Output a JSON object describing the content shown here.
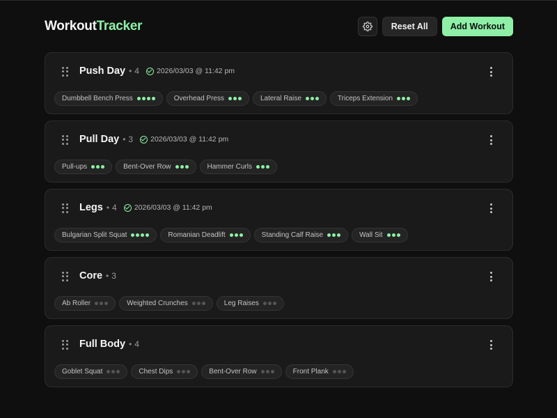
{
  "app": {
    "title_part1": "Workout",
    "title_part2": "Tracker"
  },
  "header": {
    "settings_icon": "gear-icon",
    "reset_label": "Reset All",
    "add_label": "Add Workout"
  },
  "colors": {
    "accent": "#8ef0a6",
    "background": "#0f0f0f",
    "card": "#1a1a1a",
    "dot_off": "#555555"
  },
  "workouts": [
    {
      "name": "Push Day",
      "separator": "•",
      "count": "4",
      "completed": "2026/03/03 @ 11:42 pm",
      "exercises": [
        {
          "name": "Dumbbell Bench Press",
          "sets_total": 4,
          "sets_done": 4
        },
        {
          "name": "Overhead Press",
          "sets_total": 3,
          "sets_done": 3
        },
        {
          "name": "Lateral Raise",
          "sets_total": 3,
          "sets_done": 3
        },
        {
          "name": "Triceps Extension",
          "sets_total": 3,
          "sets_done": 3
        }
      ]
    },
    {
      "name": "Pull Day",
      "separator": "•",
      "count": "3",
      "completed": "2026/03/03 @ 11:42 pm",
      "exercises": [
        {
          "name": "Pull-ups",
          "sets_total": 3,
          "sets_done": 3
        },
        {
          "name": "Bent-Over Row",
          "sets_total": 3,
          "sets_done": 3
        },
        {
          "name": "Hammer Curls",
          "sets_total": 3,
          "sets_done": 3
        }
      ]
    },
    {
      "name": "Legs",
      "separator": "•",
      "count": "4",
      "completed": "2026/03/03 @ 11:42 pm",
      "exercises": [
        {
          "name": "Bulgarian Split Squat",
          "sets_total": 4,
          "sets_done": 4
        },
        {
          "name": "Romanian Deadlift",
          "sets_total": 3,
          "sets_done": 3
        },
        {
          "name": "Standing Calf Raise",
          "sets_total": 3,
          "sets_done": 3
        },
        {
          "name": "Wall Sit",
          "sets_total": 3,
          "sets_done": 3
        }
      ]
    },
    {
      "name": "Core",
      "separator": "•",
      "count": "3",
      "completed": "",
      "exercises": [
        {
          "name": "Ab Roller",
          "sets_total": 3,
          "sets_done": 0
        },
        {
          "name": "Weighted Crunches",
          "sets_total": 3,
          "sets_done": 0
        },
        {
          "name": "Leg Raises",
          "sets_total": 3,
          "sets_done": 0
        }
      ]
    },
    {
      "name": "Full Body",
      "separator": "•",
      "count": "4",
      "completed": "",
      "exercises": [
        {
          "name": "Goblet Squat",
          "sets_total": 3,
          "sets_done": 0
        },
        {
          "name": "Chest Dips",
          "sets_total": 3,
          "sets_done": 0
        },
        {
          "name": "Bent-Over Row",
          "sets_total": 3,
          "sets_done": 0
        },
        {
          "name": "Front Plank",
          "sets_total": 3,
          "sets_done": 0
        }
      ]
    }
  ]
}
